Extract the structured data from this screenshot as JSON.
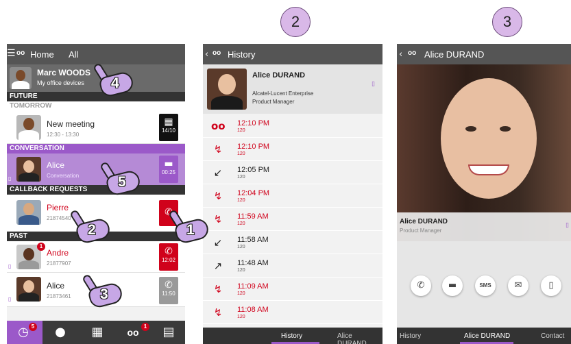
{
  "screen1": {
    "menu_icon": "menu-icon",
    "app_icon": "voicemail-logo-icon",
    "title": "Home",
    "filter": "All",
    "user": {
      "name": "Marc WOODS",
      "subtitle": "My office devices"
    },
    "sections": {
      "future": "FUTURE",
      "tomorrow": "TOMORROW",
      "conversation": "CONVERSATION",
      "callback": "CALLBACK REQUESTS",
      "past": "PAST"
    },
    "meeting": {
      "title": "New meeting",
      "time": "12:30 - 13:30",
      "date": "14/10"
    },
    "conversation": {
      "name": "Alice",
      "subtitle": "Conversation",
      "duration": "00:25"
    },
    "callback": {
      "name": "Pierre",
      "number": "21874540"
    },
    "past": [
      {
        "name": "Andre",
        "number": "21877907",
        "time": "12:02",
        "badge": "1",
        "color": "#d0021b"
      },
      {
        "name": "Alice",
        "number": "21873461",
        "time": "11:50",
        "badge": "",
        "color": "#222222"
      }
    ],
    "bottom_nav": {
      "history_badge": "5",
      "voicemail_badge": "1"
    }
  },
  "screen2": {
    "title": "History",
    "contact": {
      "name": "Alice DURAND",
      "company": "Alcatel-Lucent Enterprise",
      "role": "Product Manager"
    },
    "entries": [
      {
        "time": "12:10 PM",
        "number": "120",
        "icon": "voicemail-icon",
        "missed": true
      },
      {
        "time": "12:10 PM",
        "number": "120",
        "icon": "missed-call-icon",
        "missed": true
      },
      {
        "time": "12:05 PM",
        "number": "120",
        "icon": "incoming-call-icon",
        "missed": false
      },
      {
        "time": "12:04 PM",
        "number": "120",
        "icon": "missed-call-icon",
        "missed": true
      },
      {
        "time": "11:59 AM",
        "number": "120",
        "icon": "missed-call-icon",
        "missed": true
      },
      {
        "time": "11:58 AM",
        "number": "120",
        "icon": "incoming-call-icon",
        "missed": false
      },
      {
        "time": "11:48 AM",
        "number": "120",
        "icon": "outgoing-call-icon",
        "missed": false
      },
      {
        "time": "11:09 AM",
        "number": "120",
        "icon": "missed-call-icon",
        "missed": true
      },
      {
        "time": "11:08 AM",
        "number": "120",
        "icon": "missed-call-icon",
        "missed": true
      }
    ],
    "tabs": [
      "History",
      "Alice DURAND"
    ]
  },
  "screen3": {
    "title": "Alice DURAND",
    "name": "Alice DURAND",
    "role": "Product Manager",
    "actions": [
      "call-icon",
      "chat-icon",
      "sms-icon",
      "email-icon",
      "mobile-icon"
    ],
    "tabs": [
      "History",
      "Alice DURAND",
      "Contact"
    ]
  },
  "callouts": [
    "2",
    "3"
  ],
  "hands": [
    "4",
    "5",
    "2",
    "1",
    "3"
  ],
  "colors": {
    "purple": "#9b59c9",
    "missed": "#d0021b",
    "dark": "#333333"
  }
}
